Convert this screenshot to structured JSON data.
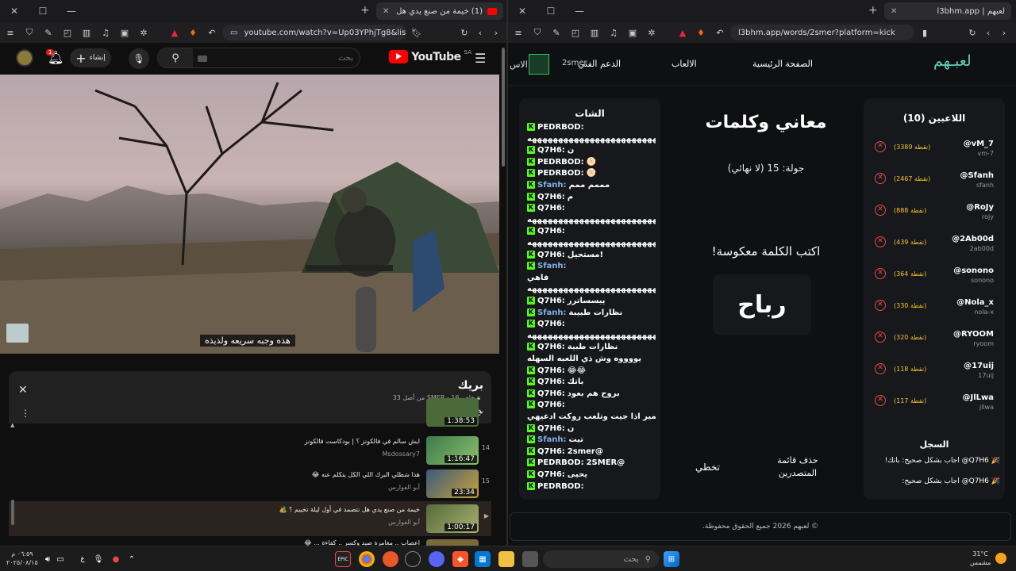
{
  "left_window": {
    "tab_title": "(1) خيمة من صنع يدي هل نتص...",
    "url": "youtube.com/watch?v=Up03YPhjTg8&list...",
    "youtube": {
      "logo_text": "YouTube",
      "region": "SA",
      "search_placeholder": "بحث",
      "create_label": "إنشاء",
      "notif_count": "1",
      "subtitle": "هذه وجبه سريعه ولذيذه"
    },
    "playlist": {
      "title": "بريك",
      "meta": "SMER - 16 من أصل 33",
      "meta_prefix": "خاص",
      "items": [
        {
          "index": "",
          "title": "",
          "channel": "",
          "duration": "1:38:53",
          "color": "#4a6a3a"
        },
        {
          "index": "14",
          "title": "ايش سالم في فالكونز ؟ | بودكاست فالكونز",
          "channel": "Msdossary7",
          "duration": "1:16:47",
          "color": "#3d7a4c"
        },
        {
          "index": "15",
          "title": "هذا شطلي البرك اللي الكل يتكلم عنه 😂",
          "channel": "أبو الفوارس",
          "duration": "23:34",
          "color": "#3a5a7a"
        },
        {
          "index": "",
          "title": "خيمة من صنع يدي هل نتصمد في أول ليلة تخييم ؟ 🏕️",
          "channel": "أبو الفوارس",
          "duration": "1:00:17",
          "color": "#556b3a"
        },
        {
          "index": "",
          "title": "اعصاب .. مغامرة صيد وكسر .. كفاءة ... 😂",
          "channel": "",
          "duration": "",
          "color": "#7a6a3a"
        }
      ]
    }
  },
  "right_window": {
    "tab_title": "لعبهم | l3bhm.app",
    "url": "l3bhm.app/words/2smer?platform=kick",
    "nav": {
      "logo": "لعبـهم",
      "home": "الصفحة الرئيسية",
      "games": "الالعاب",
      "support": "الدعم الفني",
      "user": "2smer",
      "extra": "الاس"
    },
    "players_title": "اللاعبين (10)",
    "players": [
      {
        "name": "@vM_7",
        "user": "vm-7",
        "points": "(3389 نقطة)"
      },
      {
        "name": "@Sfanh",
        "user": "sfanh",
        "points": "(2467 نقطة)"
      },
      {
        "name": "@RoJy",
        "user": "rojy",
        "points": "(888 نقطة)"
      },
      {
        "name": "@2Ab00d",
        "user": "2ab00d",
        "points": "(439 نقطة)"
      },
      {
        "name": "@sonono",
        "user": "sonono",
        "points": "(364 نقطة)"
      },
      {
        "name": "@Nola_x",
        "user": "nola-x",
        "points": "(330 نقطة)"
      },
      {
        "name": "@RYOOM",
        "user": "ryoom",
        "points": "(320 نقطة)"
      },
      {
        "name": "@17uij",
        "user": "17uij",
        "points": "(118 نقطة)"
      },
      {
        "name": "@JlLwa",
        "user": "jllwa",
        "points": "(117 نقطة)"
      }
    ],
    "log_title": "السجل",
    "log": [
      "🎉 Q7H6@ أجاب بشكل صحيح: باتك!",
      "🎉 Q7H6@ أجاب بشكل صحيح:"
    ],
    "game_title": "معاني وكلمات",
    "round_text": "جولة: 15 (لا نهائي)",
    "prompt": "اكتب الكلمة معكوسة!",
    "word": "رباح",
    "skip_label": "تخطي",
    "delete_label": "حذف قائمة المتصدرين",
    "chat_title": "الشات",
    "chat": [
      {
        "user": "PEDRBOD:",
        "msg": "",
        "color": "#ffffff"
      },
      {
        "user": "",
        "msg": "ههههههههههههههههههههههههههههههههههههه",
        "color": "#ffffff"
      },
      {
        "user": "Q7H6:",
        "msg": "ن",
        "color": "#ffffff"
      },
      {
        "user": "PEDRBOD:",
        "msg": "🫓",
        "color": "#ffffff"
      },
      {
        "user": "PEDRBOD:",
        "msg": "🫓",
        "color": "#ffffff"
      },
      {
        "user": "Sfanh:",
        "msg": "مممم ممم",
        "color": "#7fb2e5"
      },
      {
        "user": "Q7H6:",
        "msg": "م",
        "color": "#ffffff"
      },
      {
        "user": "Q7H6:",
        "msg": "",
        "color": "#ffffff"
      },
      {
        "user": "",
        "msg": "ههههههههههههههههههههههههههههههههههههه",
        "color": "#ffffff"
      },
      {
        "user": "Q7H6:",
        "msg": "",
        "color": "#ffffff"
      },
      {
        "user": "",
        "msg": "ههههههههههههههههههههههههههههههههههههه",
        "color": "#ffffff"
      },
      {
        "user": "Q7H6:",
        "msg": "مستحيل!",
        "color": "#ffffff"
      },
      {
        "user": "Sfanh:",
        "msg": "",
        "color": "#7fb2e5"
      },
      {
        "user": "",
        "msg": "فاهي",
        "color": "#ffffff"
      },
      {
        "user": "",
        "msg": "ههههههههههههههههههههههههههههههههههههه",
        "color": "#ffffff"
      },
      {
        "user": "Q7H6:",
        "msg": "ييسساترر",
        "color": "#ffffff"
      },
      {
        "user": "Sfanh:",
        "msg": "نظارات طبيبة",
        "color": "#7fb2e5"
      },
      {
        "user": "Q7H6:",
        "msg": "",
        "color": "#ffffff"
      },
      {
        "user": "",
        "msg": "ههههههههههههههههههههههههههههههههههههه",
        "color": "#ffffff"
      },
      {
        "user": "Q7H6:",
        "msg": "نظارات طبية",
        "color": "#ffffff"
      },
      {
        "user": "",
        "msg": "يووووه وش ذي اللعبه السهله",
        "color": "#ffffff"
      },
      {
        "user": "Q7H6:",
        "msg": "😂😂",
        "color": "#ffffff"
      },
      {
        "user": "Q7H6:",
        "msg": "باتك",
        "color": "#ffffff"
      },
      {
        "user": "Q7H6:",
        "msg": "بروح هم بعود",
        "color": "#ffffff"
      },
      {
        "user": "Q7H6:",
        "msg": "",
        "color": "#ffffff"
      },
      {
        "user": "",
        "msg": "سمير اذا جيت وتلعب روكت ادعيهي",
        "color": "#ffffff"
      },
      {
        "user": "Q7H6:",
        "msg": "ن",
        "color": "#ffffff"
      },
      {
        "user": "Sfanh:",
        "msg": "تيت",
        "color": "#7fb2e5"
      },
      {
        "user": "Q7H6:",
        "msg": "2smer@",
        "color": "#ffffff"
      },
      {
        "user": "PEDRBOD:",
        "msg": "2SMER@",
        "color": "#ffffff"
      },
      {
        "user": "Q7H6:",
        "msg": "يحيى",
        "color": "#ffffff"
      },
      {
        "user": "PEDRBOD:",
        "msg": "",
        "color": "#ffffff"
      }
    ],
    "footer": "© لعبهم 2026 جميع الحقوق محفوظة."
  },
  "taskbar": {
    "search_placeholder": "بحث",
    "temp": "31°C",
    "weather": "مشمس",
    "time": "٠٦:٥٩ م",
    "date": "٢٠٢٥/٠٨/١٥",
    "lang": "ع"
  },
  "colors": {
    "kick_green": "#53fc18",
    "yt_red": "#ff0000",
    "accent_teal": "#5fd3b8",
    "danger": "#e04848",
    "points": "#f4c430"
  }
}
